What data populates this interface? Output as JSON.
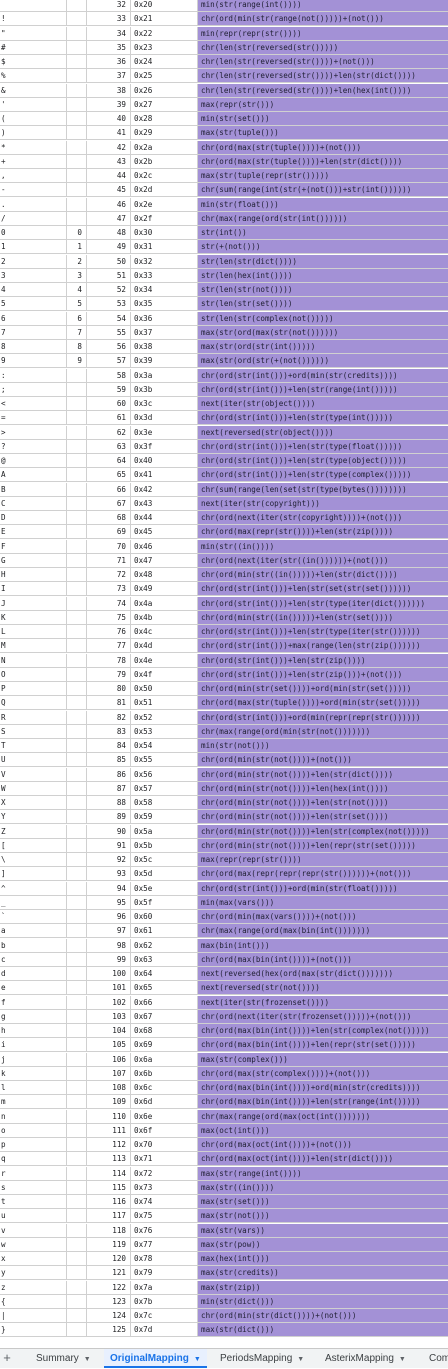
{
  "rows": [
    {
      "char": "",
      "digit": "",
      "dec": "32",
      "hex": "0x20",
      "expr": "min(str(range(int())))"
    },
    {
      "char": "!",
      "digit": "",
      "dec": "33",
      "hex": "0x21",
      "expr": "chr(ord(min(str(range(not()))))+(not()))"
    },
    {
      "char": "\"",
      "digit": "",
      "dec": "34",
      "hex": "0x22",
      "expr": "min(repr(repr(str())))"
    },
    {
      "char": "#",
      "digit": "",
      "dec": "35",
      "hex": "0x23",
      "expr": "chr(len(str(reversed(str()))))"
    },
    {
      "char": "$",
      "digit": "",
      "dec": "36",
      "hex": "0x24",
      "expr": "chr(len(str(reversed(str())))+(not()))"
    },
    {
      "char": "%",
      "digit": "",
      "dec": "37",
      "hex": "0x25",
      "expr": "chr(len(str(reversed(str())))+len(str(dict())))"
    },
    {
      "char": "&",
      "digit": "",
      "dec": "38",
      "hex": "0x26",
      "expr": "chr(len(str(reversed(str())))+len(hex(int())))"
    },
    {
      "char": "'",
      "digit": "",
      "dec": "39",
      "hex": "0x27",
      "expr": "max(repr(str()))"
    },
    {
      "char": "(",
      "digit": "",
      "dec": "40",
      "hex": "0x28",
      "expr": "min(str(set()))"
    },
    {
      "char": ")",
      "digit": "",
      "dec": "41",
      "hex": "0x29",
      "expr": "max(str(tuple()))"
    },
    {
      "char": "*",
      "digit": "",
      "dec": "42",
      "hex": "0x2a",
      "expr": "chr(ord(max(str(tuple())))+(not()))"
    },
    {
      "char": "+",
      "digit": "",
      "dec": "43",
      "hex": "0x2b",
      "expr": "chr(ord(max(str(tuple())))+len(str(dict())))"
    },
    {
      "char": ",",
      "digit": "",
      "dec": "44",
      "hex": "0x2c",
      "expr": "max(str(tuple(repr(str()))))"
    },
    {
      "char": "-",
      "digit": "",
      "dec": "45",
      "hex": "0x2d",
      "expr": "chr(sum(range(int(str(+(not()))+str(int())))))"
    },
    {
      "char": ".",
      "digit": "",
      "dec": "46",
      "hex": "0x2e",
      "expr": "min(str(float()))"
    },
    {
      "char": "/",
      "digit": "",
      "dec": "47",
      "hex": "0x2f",
      "expr": "chr(max(range(ord(str(int())))))"
    },
    {
      "char": "0",
      "digit": "0",
      "dec": "48",
      "hex": "0x30",
      "expr": "str(int())"
    },
    {
      "char": "1",
      "digit": "1",
      "dec": "49",
      "hex": "0x31",
      "expr": "str(+(not()))"
    },
    {
      "char": "2",
      "digit": "2",
      "dec": "50",
      "hex": "0x32",
      "expr": "str(len(str(dict())))"
    },
    {
      "char": "3",
      "digit": "3",
      "dec": "51",
      "hex": "0x33",
      "expr": "str(len(hex(int())))"
    },
    {
      "char": "4",
      "digit": "4",
      "dec": "52",
      "hex": "0x34",
      "expr": "str(len(str(not())))"
    },
    {
      "char": "5",
      "digit": "5",
      "dec": "53",
      "hex": "0x35",
      "expr": "str(len(str(set())))"
    },
    {
      "char": "6",
      "digit": "6",
      "dec": "54",
      "hex": "0x36",
      "expr": "str(len(str(complex(not()))))"
    },
    {
      "char": "7",
      "digit": "7",
      "dec": "55",
      "hex": "0x37",
      "expr": "max(str(ord(max(str(not())))))"
    },
    {
      "char": "8",
      "digit": "8",
      "dec": "56",
      "hex": "0x38",
      "expr": "max(str(ord(str(int()))))"
    },
    {
      "char": "9",
      "digit": "9",
      "dec": "57",
      "hex": "0x39",
      "expr": "max(str(ord(str(+(not())))))"
    },
    {
      "char": ":",
      "digit": "",
      "dec": "58",
      "hex": "0x3a",
      "expr": "chr(ord(str(int()))+ord(min(str(credits))))"
    },
    {
      "char": ";",
      "digit": "",
      "dec": "59",
      "hex": "0x3b",
      "expr": "chr(ord(str(int()))+len(str(range(int()))))"
    },
    {
      "char": "<",
      "digit": "",
      "dec": "60",
      "hex": "0x3c",
      "expr": "next(iter(str(object())))"
    },
    {
      "char": "=",
      "digit": "",
      "dec": "61",
      "hex": "0x3d",
      "expr": "chr(ord(str(int()))+len(str(type(int()))))"
    },
    {
      "char": ">",
      "digit": "",
      "dec": "62",
      "hex": "0x3e",
      "expr": "next(reversed(str(object())))"
    },
    {
      "char": "?",
      "digit": "",
      "dec": "63",
      "hex": "0x3f",
      "expr": "chr(ord(str(int()))+len(str(type(float()))))"
    },
    {
      "char": "@",
      "digit": "",
      "dec": "64",
      "hex": "0x40",
      "expr": "chr(ord(str(int()))+len(str(type(object()))))"
    },
    {
      "char": "A",
      "digit": "",
      "dec": "65",
      "hex": "0x41",
      "expr": "chr(ord(str(int()))+len(str(type(complex()))))"
    },
    {
      "char": "B",
      "digit": "",
      "dec": "66",
      "hex": "0x42",
      "expr": "chr(sum(range(len(set(str(type(bytes())))))))"
    },
    {
      "char": "C",
      "digit": "",
      "dec": "67",
      "hex": "0x43",
      "expr": "next(iter(str(copyright)))"
    },
    {
      "char": "D",
      "digit": "",
      "dec": "68",
      "hex": "0x44",
      "expr": "chr(ord(next(iter(str(copyright))))+(not()))"
    },
    {
      "char": "E",
      "digit": "",
      "dec": "69",
      "hex": "0x45",
      "expr": "chr(ord(max(repr(str())))+len(str(zip())))"
    },
    {
      "char": "F",
      "digit": "",
      "dec": "70",
      "hex": "0x46",
      "expr": "min(str((in())))"
    },
    {
      "char": "G",
      "digit": "",
      "dec": "71",
      "hex": "0x47",
      "expr": "chr(ord(next(iter(str((in())))))+(not()))"
    },
    {
      "char": "H",
      "digit": "",
      "dec": "72",
      "hex": "0x48",
      "expr": "chr(ord(min(str((in()))))+len(str(dict())))"
    },
    {
      "char": "I",
      "digit": "",
      "dec": "73",
      "hex": "0x49",
      "expr": "chr(ord(str(int()))+len(str(set(str(set())))))"
    },
    {
      "char": "J",
      "digit": "",
      "dec": "74",
      "hex": "0x4a",
      "expr": "chr(ord(str(int()))+len(str(type(iter(dict())))))"
    },
    {
      "char": "K",
      "digit": "",
      "dec": "75",
      "hex": "0x4b",
      "expr": "chr(ord(min(str((in()))))+len(str(set())))"
    },
    {
      "char": "L",
      "digit": "",
      "dec": "76",
      "hex": "0x4c",
      "expr": "chr(ord(str(int()))+len(str(type(iter(str())))))"
    },
    {
      "char": "M",
      "digit": "",
      "dec": "77",
      "hex": "0x4d",
      "expr": "chr(ord(str(int()))+max(range(len(str(zip())))))"
    },
    {
      "char": "N",
      "digit": "",
      "dec": "78",
      "hex": "0x4e",
      "expr": "chr(ord(str(int()))+len(str(zip())))"
    },
    {
      "char": "O",
      "digit": "",
      "dec": "79",
      "hex": "0x4f",
      "expr": "chr(ord(str(int()))+len(str(zip()))+(not()))"
    },
    {
      "char": "P",
      "digit": "",
      "dec": "80",
      "hex": "0x50",
      "expr": "chr(ord(min(str(set())))+ord(min(str(set()))))"
    },
    {
      "char": "Q",
      "digit": "",
      "dec": "81",
      "hex": "0x51",
      "expr": "chr(ord(max(str(tuple())))+ord(min(str(set()))))"
    },
    {
      "char": "R",
      "digit": "",
      "dec": "82",
      "hex": "0x52",
      "expr": "chr(ord(str(int()))+ord(min(repr(repr(str())))))"
    },
    {
      "char": "S",
      "digit": "",
      "dec": "83",
      "hex": "0x53",
      "expr": "chr(max(range(ord(min(str(not()))))))"
    },
    {
      "char": "T",
      "digit": "",
      "dec": "84",
      "hex": "0x54",
      "expr": "min(str(not()))"
    },
    {
      "char": "U",
      "digit": "",
      "dec": "85",
      "hex": "0x55",
      "expr": "chr(ord(min(str(not())))+(not()))"
    },
    {
      "char": "V",
      "digit": "",
      "dec": "86",
      "hex": "0x56",
      "expr": "chr(ord(min(str(not())))+len(str(dict())))"
    },
    {
      "char": "W",
      "digit": "",
      "dec": "87",
      "hex": "0x57",
      "expr": "chr(ord(min(str(not())))+len(hex(int())))"
    },
    {
      "char": "X",
      "digit": "",
      "dec": "88",
      "hex": "0x58",
      "expr": "chr(ord(min(str(not())))+len(str(not())))"
    },
    {
      "char": "Y",
      "digit": "",
      "dec": "89",
      "hex": "0x59",
      "expr": "chr(ord(min(str(not())))+len(str(set())))"
    },
    {
      "char": "Z",
      "digit": "",
      "dec": "90",
      "hex": "0x5a",
      "expr": "chr(ord(min(str(not())))+len(str(complex(not()))))"
    },
    {
      "char": "[",
      "digit": "",
      "dec": "91",
      "hex": "0x5b",
      "expr": "chr(ord(min(str(not())))+len(repr(str(set()))))"
    },
    {
      "char": "\\",
      "digit": "",
      "dec": "92",
      "hex": "0x5c",
      "expr": "max(repr(repr(str())))"
    },
    {
      "char": "]",
      "digit": "",
      "dec": "93",
      "hex": "0x5d",
      "expr": "chr(ord(max(repr(repr(repr(str())))))+(not()))"
    },
    {
      "char": "^",
      "digit": "",
      "dec": "94",
      "hex": "0x5e",
      "expr": "chr(ord(str(int()))+ord(min(str(float()))))"
    },
    {
      "char": "_",
      "digit": "",
      "dec": "95",
      "hex": "0x5f",
      "expr": "min(max(vars()))"
    },
    {
      "char": "`",
      "digit": "",
      "dec": "96",
      "hex": "0x60",
      "expr": "chr(ord(min(max(vars())))+(not()))"
    },
    {
      "char": "a",
      "digit": "",
      "dec": "97",
      "hex": "0x61",
      "expr": "chr(max(range(ord(max(bin(int()))))))"
    },
    {
      "char": "b",
      "digit": "",
      "dec": "98",
      "hex": "0x62",
      "expr": "max(bin(int()))"
    },
    {
      "char": "c",
      "digit": "",
      "dec": "99",
      "hex": "0x63",
      "expr": "chr(ord(max(bin(int())))+(not()))"
    },
    {
      "char": "d",
      "digit": "",
      "dec": "100",
      "hex": "0x64",
      "expr": "next(reversed(hex(ord(max(str(dict()))))))"
    },
    {
      "char": "e",
      "digit": "",
      "dec": "101",
      "hex": "0x65",
      "expr": "next(reversed(str(not())))"
    },
    {
      "char": "f",
      "digit": "",
      "dec": "102",
      "hex": "0x66",
      "expr": "next(iter(str(frozenset())))"
    },
    {
      "char": "g",
      "digit": "",
      "dec": "103",
      "hex": "0x67",
      "expr": "chr(ord(next(iter(str(frozenset()))))+(not()))"
    },
    {
      "char": "h",
      "digit": "",
      "dec": "104",
      "hex": "0x68",
      "expr": "chr(ord(max(bin(int())))+len(str(complex(not()))))"
    },
    {
      "char": "i",
      "digit": "",
      "dec": "105",
      "hex": "0x69",
      "expr": "chr(ord(max(bin(int())))+len(repr(str(set()))))"
    },
    {
      "char": "j",
      "digit": "",
      "dec": "106",
      "hex": "0x6a",
      "expr": "max(str(complex()))"
    },
    {
      "char": "k",
      "digit": "",
      "dec": "107",
      "hex": "0x6b",
      "expr": "chr(ord(max(str(complex())))+(not()))"
    },
    {
      "char": "l",
      "digit": "",
      "dec": "108",
      "hex": "0x6c",
      "expr": "chr(ord(max(bin(int())))+ord(min(str(credits))))"
    },
    {
      "char": "m",
      "digit": "",
      "dec": "109",
      "hex": "0x6d",
      "expr": "chr(ord(max(bin(int())))+len(str(range(int()))))"
    },
    {
      "char": "n",
      "digit": "",
      "dec": "110",
      "hex": "0x6e",
      "expr": "chr(max(range(ord(max(oct(int()))))))"
    },
    {
      "char": "o",
      "digit": "",
      "dec": "111",
      "hex": "0x6f",
      "expr": "max(oct(int()))"
    },
    {
      "char": "p",
      "digit": "",
      "dec": "112",
      "hex": "0x70",
      "expr": "chr(ord(max(oct(int())))+(not()))"
    },
    {
      "char": "q",
      "digit": "",
      "dec": "113",
      "hex": "0x71",
      "expr": "chr(ord(max(oct(int())))+len(str(dict())))"
    },
    {
      "char": "r",
      "digit": "",
      "dec": "114",
      "hex": "0x72",
      "expr": "max(str(range(int())))"
    },
    {
      "char": "s",
      "digit": "",
      "dec": "115",
      "hex": "0x73",
      "expr": "max(str((in())))"
    },
    {
      "char": "t",
      "digit": "",
      "dec": "116",
      "hex": "0x74",
      "expr": "max(str(set()))"
    },
    {
      "char": "u",
      "digit": "",
      "dec": "117",
      "hex": "0x75",
      "expr": "max(str(not()))"
    },
    {
      "char": "v",
      "digit": "",
      "dec": "118",
      "hex": "0x76",
      "expr": "max(str(vars))"
    },
    {
      "char": "w",
      "digit": "",
      "dec": "119",
      "hex": "0x77",
      "expr": "max(str(pow))"
    },
    {
      "char": "x",
      "digit": "",
      "dec": "120",
      "hex": "0x78",
      "expr": "max(hex(int()))"
    },
    {
      "char": "y",
      "digit": "",
      "dec": "121",
      "hex": "0x79",
      "expr": "max(str(credits))"
    },
    {
      "char": "z",
      "digit": "",
      "dec": "122",
      "hex": "0x7a",
      "expr": "max(str(zip))"
    },
    {
      "char": "{",
      "digit": "",
      "dec": "123",
      "hex": "0x7b",
      "expr": "min(str(dict()))"
    },
    {
      "char": "|",
      "digit": "",
      "dec": "124",
      "hex": "0x7c",
      "expr": "chr(ord(min(str(dict())))+(not()))"
    },
    {
      "char": "}",
      "digit": "",
      "dec": "125",
      "hex": "0x7d",
      "expr": "max(str(dict()))"
    }
  ],
  "tabbar": {
    "add_icon": "+",
    "tabs": [
      {
        "label": "Summary",
        "active": false
      },
      {
        "label": "OriginalMapping",
        "active": true
      },
      {
        "label": "PeriodsMapping",
        "active": false
      },
      {
        "label": "AsterixMapping",
        "active": false
      },
      {
        "label": "Com",
        "active": false
      }
    ]
  },
  "colors": {
    "expr_column_bg": "#a391d6",
    "active_tab": "#1a73e8",
    "grid_line": "#d0d0d0"
  }
}
